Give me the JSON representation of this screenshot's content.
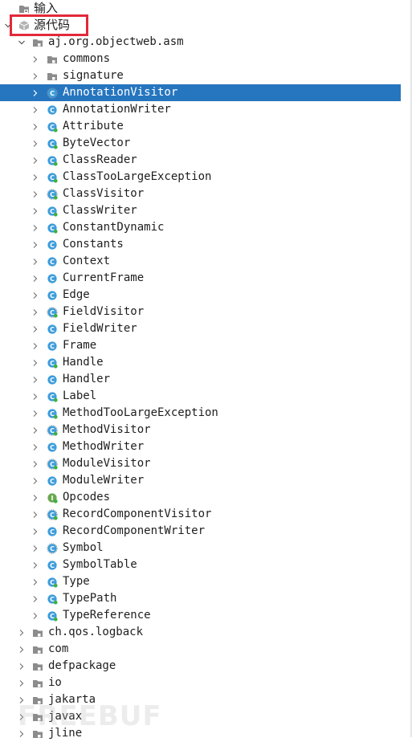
{
  "tree": {
    "top_nodes": [
      {
        "label": "输入",
        "icon": "folder-module-icon"
      },
      {
        "label": "源代码",
        "icon": "package-cube-icon"
      }
    ],
    "root_package": {
      "label": "aj.org.objectweb.asm",
      "icon": "package-folder-icon"
    },
    "subpackages": [
      {
        "label": "commons",
        "icon": "package-folder-icon"
      },
      {
        "label": "signature",
        "icon": "package-folder-icon"
      }
    ],
    "classes": [
      {
        "label": "AnnotationVisitor",
        "kind": "abstract-class",
        "badge": false,
        "selected": true
      },
      {
        "label": "AnnotationWriter",
        "kind": "class",
        "badge": false
      },
      {
        "label": "Attribute",
        "kind": "class",
        "badge": true
      },
      {
        "label": "ByteVector",
        "kind": "class",
        "badge": true
      },
      {
        "label": "ClassReader",
        "kind": "class",
        "badge": true
      },
      {
        "label": "ClassTooLargeException",
        "kind": "class",
        "badge": true
      },
      {
        "label": "ClassVisitor",
        "kind": "abstract-class",
        "badge": true
      },
      {
        "label": "ClassWriter",
        "kind": "class",
        "badge": true
      },
      {
        "label": "ConstantDynamic",
        "kind": "class",
        "badge": true
      },
      {
        "label": "Constants",
        "kind": "class",
        "badge": false
      },
      {
        "label": "Context",
        "kind": "class",
        "badge": false
      },
      {
        "label": "CurrentFrame",
        "kind": "class",
        "badge": false
      },
      {
        "label": "Edge",
        "kind": "class",
        "badge": false
      },
      {
        "label": "FieldVisitor",
        "kind": "abstract-class",
        "badge": true
      },
      {
        "label": "FieldWriter",
        "kind": "class",
        "badge": false
      },
      {
        "label": "Frame",
        "kind": "class",
        "badge": false
      },
      {
        "label": "Handle",
        "kind": "class",
        "badge": true
      },
      {
        "label": "Handler",
        "kind": "class",
        "badge": false
      },
      {
        "label": "Label",
        "kind": "class",
        "badge": true
      },
      {
        "label": "MethodTooLargeException",
        "kind": "class",
        "badge": true
      },
      {
        "label": "MethodVisitor",
        "kind": "abstract-class",
        "badge": true
      },
      {
        "label": "MethodWriter",
        "kind": "class",
        "badge": false
      },
      {
        "label": "ModuleVisitor",
        "kind": "abstract-class",
        "badge": true
      },
      {
        "label": "ModuleWriter",
        "kind": "class",
        "badge": false
      },
      {
        "label": "Opcodes",
        "kind": "interface",
        "badge": true
      },
      {
        "label": "RecordComponentVisitor",
        "kind": "abstract-class",
        "badge": true
      },
      {
        "label": "RecordComponentWriter",
        "kind": "class",
        "badge": false
      },
      {
        "label": "Symbol",
        "kind": "abstract-class",
        "badge": false
      },
      {
        "label": "SymbolTable",
        "kind": "class",
        "badge": false
      },
      {
        "label": "Type",
        "kind": "class",
        "badge": true
      },
      {
        "label": "TypePath",
        "kind": "class",
        "badge": true
      },
      {
        "label": "TypeReference",
        "kind": "class",
        "badge": true
      }
    ],
    "sibling_packages": [
      {
        "label": "ch.qos.logback",
        "icon": "package-folder-icon"
      },
      {
        "label": "com",
        "icon": "package-folder-icon"
      },
      {
        "label": "defpackage",
        "icon": "package-folder-icon"
      },
      {
        "label": "io",
        "icon": "package-folder-icon"
      },
      {
        "label": "jakarta",
        "icon": "package-folder-icon"
      },
      {
        "label": "javax",
        "icon": "package-folder-icon"
      },
      {
        "label": "jline",
        "icon": "package-folder-icon"
      }
    ]
  },
  "watermark": "FREEBUF",
  "colors": {
    "selection": "#2675bf",
    "class_icon": "#3d9ddb",
    "interface_icon": "#6aa84f",
    "badge": "#3cb043",
    "annotation_box": "#e2293a",
    "folder": "#8c8c8c"
  }
}
